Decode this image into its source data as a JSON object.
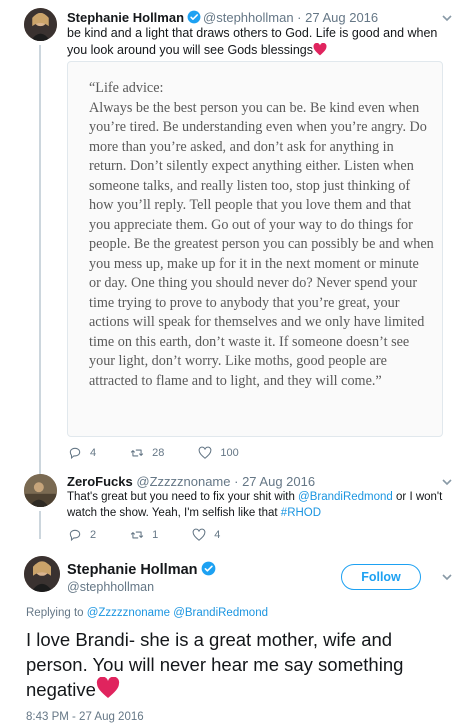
{
  "tweet1": {
    "name": "Stephanie Hollman",
    "handle": "@stephhollman",
    "date": "27 Aug 2016",
    "text": "be kind and a light that draws others to God.  Life is good and when you look around you will see Gods blessings",
    "quote": "“Life advice:\nAlways be the best person you can be. Be kind even when you’re tired. Be understanding even when you’re angry. Do more than you’re asked, and don’t ask for anything in return. Don’t silently expect anything either. Listen when someone talks, and really listen too, stop just thinking of how you’ll reply. Tell people that you love them and that you appreciate them. Go out of your way to do things for people. Be the greatest person you can possibly be and when you mess up, make up for it in the next moment or minute or day. One thing you should never do? Never spend your time trying to prove to anybody that you’re great, your actions will speak for themselves and we only have limited time on this earth, don’t waste it. If someone doesn’t see your light, don’t worry. Like moths, good people are attracted to flame and to light, and they will come.”",
    "replies": "4",
    "retweets": "28",
    "likes": "100"
  },
  "tweet2": {
    "name": "ZeroFucks",
    "handle": "@Zzzzznoname",
    "date": "27 Aug 2016",
    "text_before": "That's great but you need to fix your shit with ",
    "mention": "@BrandiRedmond",
    "text_middle": "  or I won't watch the show. Yeah, I'm selfish like that ",
    "hashtag": "#RHOD",
    "replies": "2",
    "retweets": "1",
    "likes": "4"
  },
  "main": {
    "name": "Stephanie Hollman",
    "handle": "@stephhollman",
    "follow_label": "Follow",
    "replying_to_label": "Replying to ",
    "replying_to_1": "@Zzzzznoname",
    "replying_to_2": "@BrandiRedmond",
    "text": "I love Brandi- she is a great mother, wife and person.  You will never hear me say something negative",
    "timestamp": "8:43 PM - 27 Aug 2016"
  },
  "icons": {
    "verified": "verified-badge-icon",
    "reply": "reply-icon",
    "retweet": "retweet-icon",
    "like": "heart-outline-icon",
    "caret": "chevron-down-icon",
    "heart": "red-heart-emoji-icon"
  },
  "colors": {
    "link": "#1b95e0",
    "accent": "#1da1f2",
    "heart": "#e0245e",
    "muted": "#657786"
  }
}
